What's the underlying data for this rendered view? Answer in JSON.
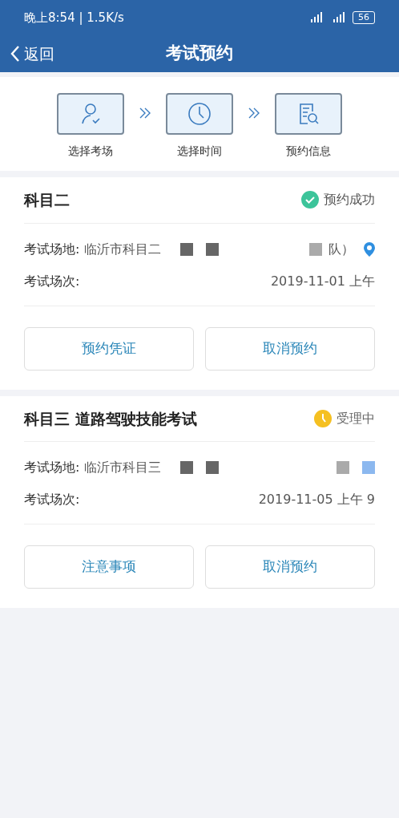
{
  "status_bar": {
    "time": "晚上8:54 | 1.5K/s",
    "battery": "56"
  },
  "header": {
    "back": "返回",
    "title": "考试预约"
  },
  "steps": [
    {
      "kind": "person",
      "label": "选择考场"
    },
    {
      "kind": "clock",
      "label": "选择时间"
    },
    {
      "kind": "document",
      "label": "预约信息"
    }
  ],
  "bookings": [
    {
      "subject": "科目二",
      "status": {
        "kind": "success",
        "label": "预约成功"
      },
      "venue_label": "考试场地:",
      "venue_start": "临沂市科目二",
      "venue_end": "队）",
      "has_location": true,
      "session_label": "考试场次:",
      "session": "2019-11-01 上午",
      "buttons": [
        "预约凭证",
        "取消预约"
      ]
    },
    {
      "subject": "科目三 道路驾驶技能考试",
      "status": {
        "kind": "pending",
        "label": "受理中"
      },
      "venue_label": "考试场地:",
      "venue_start": "临沂市科目三",
      "has_location": false,
      "session_label": "考试场次:",
      "session": "2019-11-05 上午 9",
      "buttons": [
        "注意事项",
        "取消预约"
      ]
    }
  ]
}
